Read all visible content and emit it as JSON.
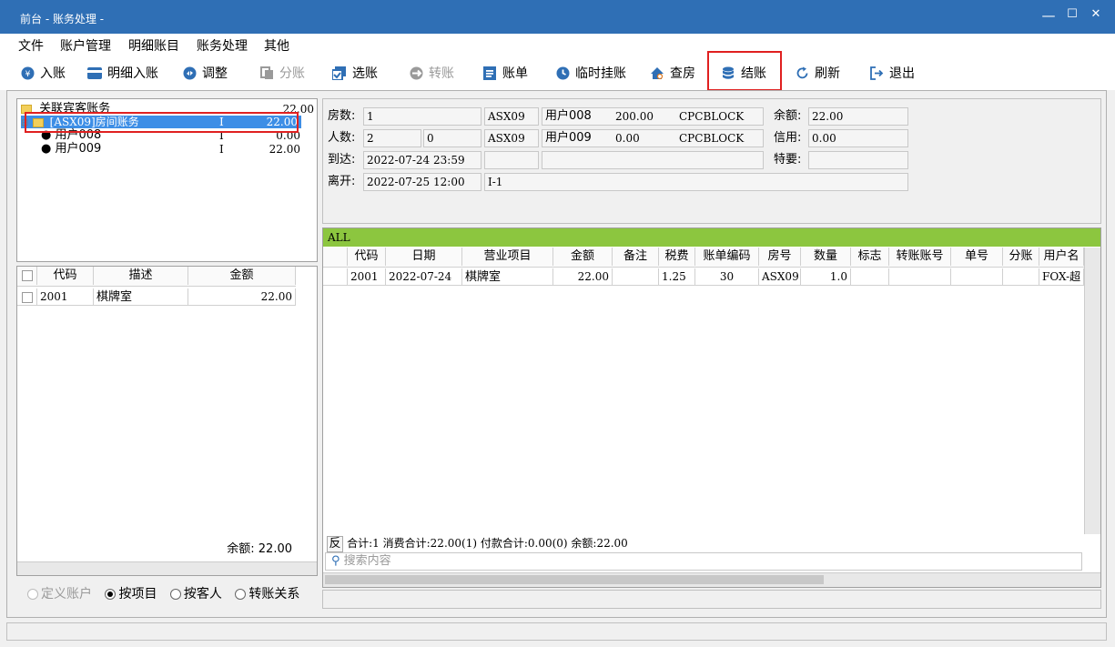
{
  "window": {
    "title": "前台 - 账务处理 -",
    "min": "—",
    "max": "☐",
    "close": "✕"
  },
  "menu": [
    "文件",
    "账户管理",
    "明细账目",
    "账务处理",
    "其他"
  ],
  "toolbar": {
    "post": "入账",
    "detail_post": "明细入账",
    "adjust": "调整",
    "split": "分账",
    "select": "选账",
    "transfer": "转账",
    "bill": "账单",
    "temp_hang": "临时挂账",
    "check_room": "查房",
    "checkout": "结账",
    "refresh": "刷新",
    "exit": "退出"
  },
  "tree": {
    "root": {
      "label": "关联宾客账务",
      "amount": "22.00"
    },
    "room": {
      "label": "[ASX09]房间账务",
      "flag": "I",
      "amount": "22.00"
    },
    "users": [
      {
        "label": "用户008",
        "flag": "I",
        "amount": "0.00"
      },
      {
        "label": "用户009",
        "flag": "I",
        "amount": "22.00"
      }
    ]
  },
  "items_table": {
    "headers": {
      "code": "代码",
      "desc": "描述",
      "amount": "金额"
    },
    "rows": [
      {
        "code": "2001",
        "desc": "棋牌室",
        "amount": "22.00"
      }
    ],
    "balance": "余额: 22.00"
  },
  "radios": {
    "defined": "定义账户",
    "by_item": "按项目",
    "by_guest": "按客人",
    "transfer_rel": "转账关系"
  },
  "info": {
    "rooms_label": "房数:",
    "rooms": "1",
    "persons_label": "人数:",
    "persons": "2",
    "persons_extra": "0",
    "arrive_label": "到达:",
    "arrive": "2022-07-24 23:59",
    "depart_label": "离开:",
    "depart": "2022-07-25 12:00",
    "depart_extra": "I-1",
    "guest1": {
      "room": "ASX09",
      "name": "用户008",
      "amount": "200.00",
      "code": "CPCBLOCK"
    },
    "guest2": {
      "room": "ASX09",
      "name": "用户009",
      "amount": "0.00",
      "code": "CPCBLOCK"
    },
    "balance_label": "余额:",
    "balance": "22.00",
    "credit_label": "信用:",
    "credit": "0.00",
    "special_label": "特要:",
    "special": ""
  },
  "grid": {
    "tab": "ALL",
    "headers": [
      "代码",
      "日期",
      "营业项目",
      "金额",
      "备注",
      "税费",
      "账单编码",
      "房号",
      "数量",
      "标志",
      "转账账号",
      "单号",
      "分账",
      "用户名"
    ],
    "rows": [
      [
        "2001",
        "2022-07-24",
        "棋牌室",
        "22.00",
        "",
        "1.25",
        "30",
        "ASX09",
        "1.0",
        "",
        "",
        "",
        "",
        "FOX-超"
      ]
    ],
    "footer": {
      "rev": "反",
      "summary": "合计:1  消费合计:22.00(1)  付款合计:0.00(0)  余额:22.00"
    },
    "search_placeholder": "搜索内容"
  }
}
